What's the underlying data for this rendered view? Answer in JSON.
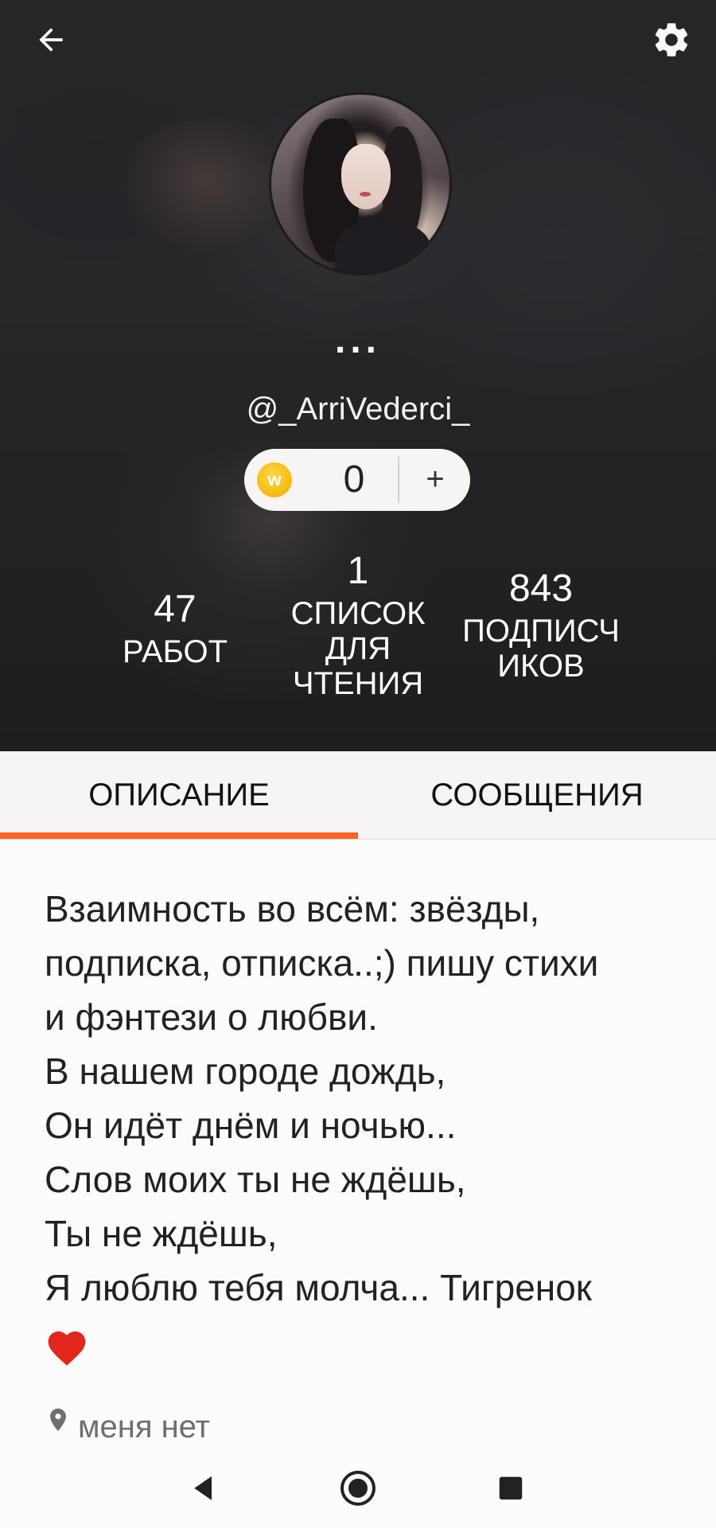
{
  "header": {
    "back_icon": "arrow-left-icon",
    "settings_icon": "gear-icon",
    "display_name": "...",
    "username": "@_ArriVederci_"
  },
  "coins": {
    "icon": "wattpad-coin-icon",
    "icon_letter": "w",
    "value": "0",
    "add_label": "+"
  },
  "stats": {
    "works": {
      "value": "47",
      "label": "РАБОТ"
    },
    "reading_lists": {
      "value": "1",
      "label_lines": [
        "СПИСОК",
        "ДЛЯ",
        "ЧТЕНИЯ"
      ]
    },
    "followers": {
      "value": "843",
      "label_lines": [
        "ПОДПИСЧ",
        "ИКОВ"
      ]
    }
  },
  "tabs": [
    {
      "label": "ОПИСАНИЕ",
      "active": true
    },
    {
      "label": "СООБЩЕНИЯ",
      "active": false
    }
  ],
  "about": {
    "text": "Взаимность во всём: звёзды,\nподписка, отписка..;) пишу стихи\nи фэнтези о любви.\nВ нашем городе дождь,\nОн идёт днём и ночью...\nСлов моих ты не ждёшь,\nТы не ждёшь,\nЯ люблю тебя молча... Тигренок",
    "emoji": "red-heart-icon"
  },
  "location": {
    "icon": "location-pin-icon",
    "text": "меня нет"
  },
  "navbar": {
    "back_icon": "nav-back-triangle-icon",
    "home_icon": "nav-home-circle-icon",
    "recents_icon": "nav-recents-square-icon"
  },
  "colors": {
    "accent": "#ff6122",
    "cover_dark": "#2b2a2d",
    "coin_gold": "#f5b90c",
    "heart_red": "#e1261c"
  }
}
